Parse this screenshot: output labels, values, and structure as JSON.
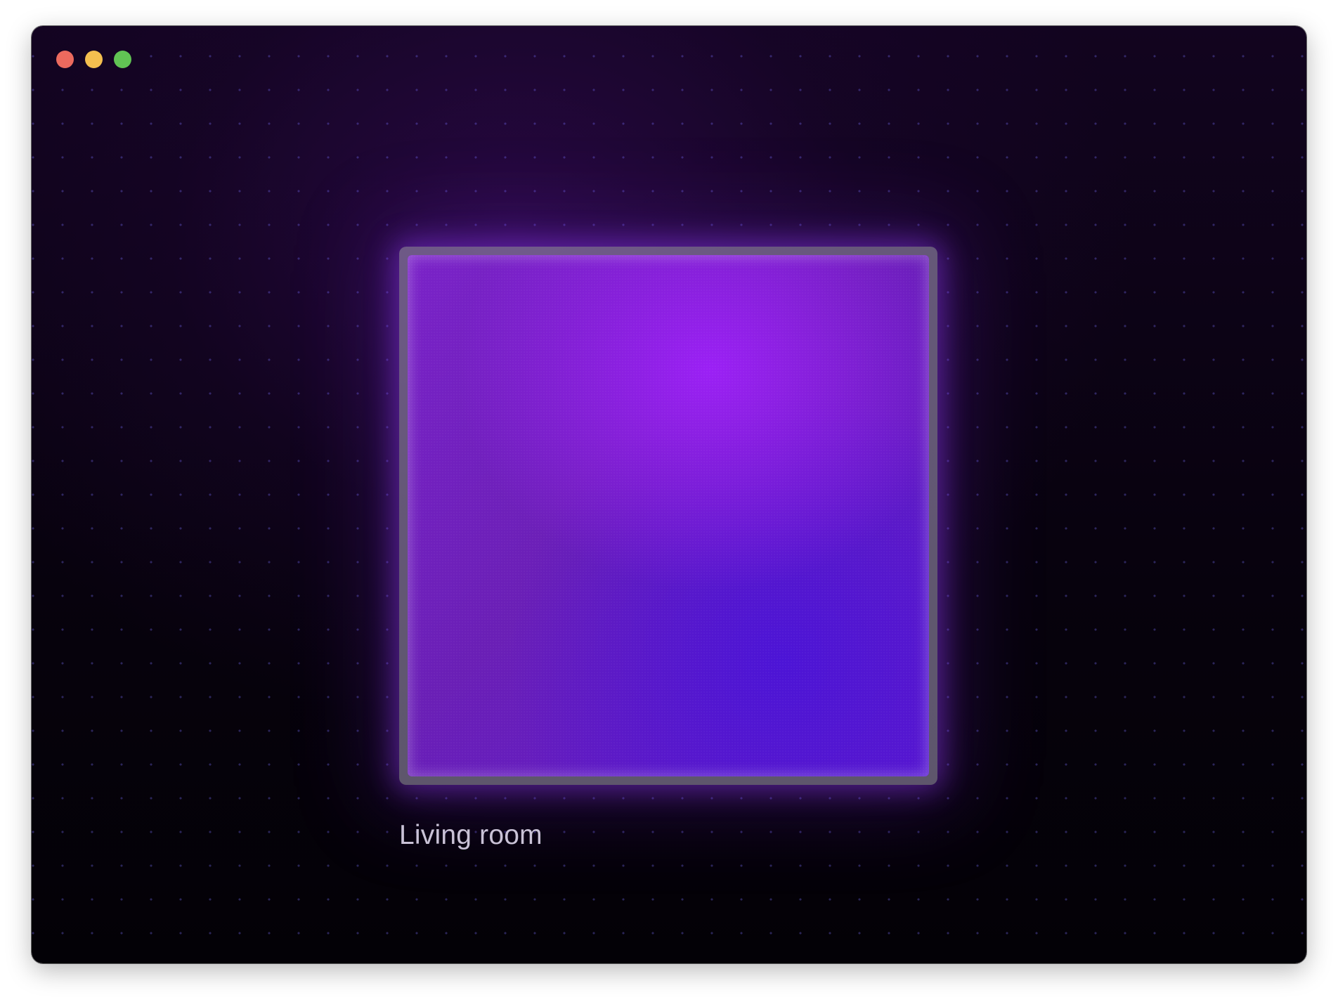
{
  "window": {
    "controls": [
      "close",
      "minimize",
      "zoom"
    ],
    "control_colors": {
      "close": "#ec6a5e",
      "minimize": "#f4bf4f",
      "zoom": "#61c454"
    }
  },
  "tile": {
    "label": "Living room",
    "colors": {
      "glow": "#9b20f5",
      "primary": "#7a22c8",
      "secondary": "#4c14d6"
    }
  }
}
